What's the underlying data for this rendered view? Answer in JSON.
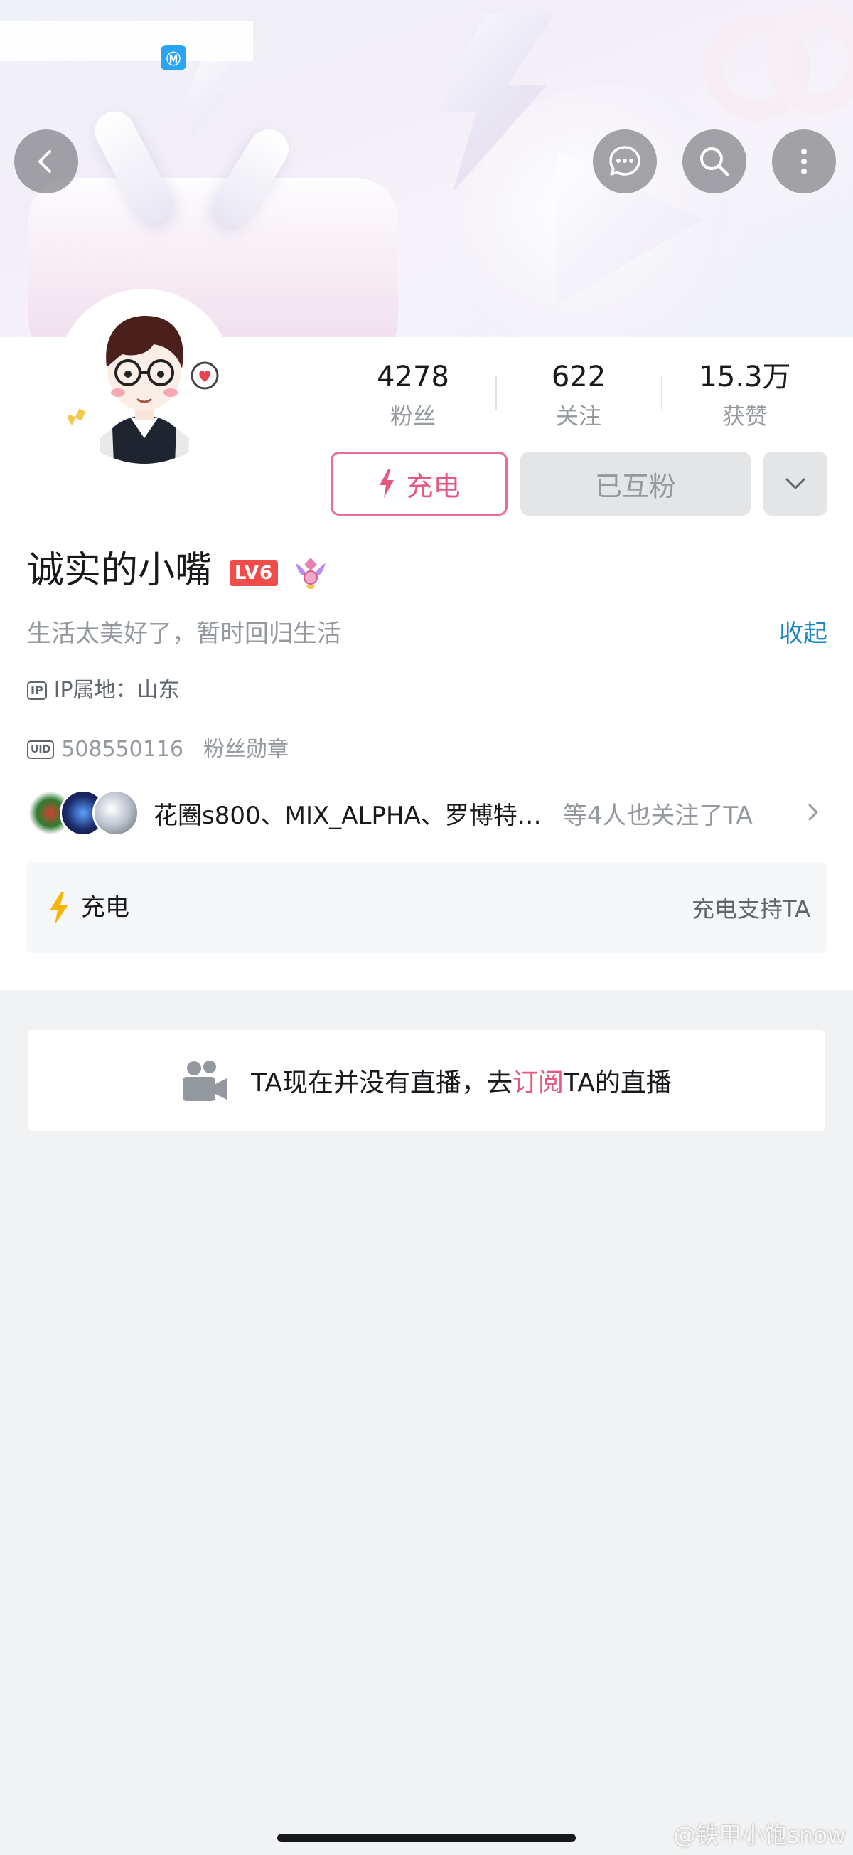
{
  "header": {
    "status_app_icon": "Ⓜ",
    "back_icon": "chevron-left",
    "message_icon": "message-bubble",
    "search_icon": "magnifier",
    "more_icon": "vertical-dots"
  },
  "stats": [
    {
      "value": "4278",
      "label": "粉丝"
    },
    {
      "value": "622",
      "label": "关注"
    },
    {
      "value": "15.3万",
      "label": "获赞"
    }
  ],
  "actions": {
    "charge_label": "充电",
    "follow_label": "已互粉"
  },
  "user": {
    "name": "诚实的小嘴",
    "level": "LV6",
    "bio": "生活太美好了，暂时回归生活",
    "collapse_label": "收起",
    "ip_tag": "IP",
    "ip_text": "IP属地：山东",
    "uid_tag": "UID",
    "uid": "508550116",
    "fan_medal_label": "粉丝勋章"
  },
  "mutual_follow": {
    "names": "花圈s800、MIX_ALPHA、罗博特…",
    "suffix": "等4人也关注了TA"
  },
  "charge_card": {
    "title": "充电",
    "right_text": "充电支持TA"
  },
  "live": {
    "text_before": "TA现在并没有直播，去",
    "link_text": "订阅",
    "text_after": "TA的直播"
  },
  "watermark": "@铁甲小饱snow",
  "colors": {
    "accent_pink": "#e6587f",
    "link_blue": "#1f86c6",
    "level_red": "#f04c49",
    "bolt_yellow": "#f7b500"
  }
}
